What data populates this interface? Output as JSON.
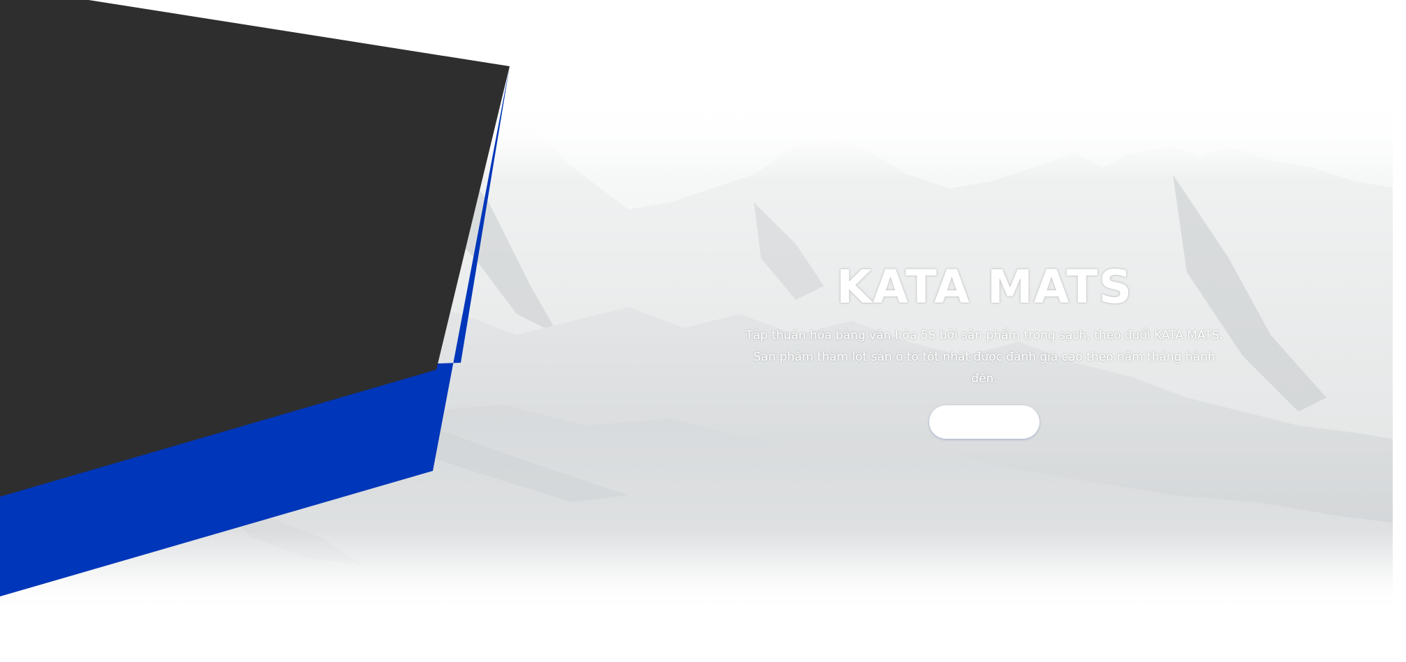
{
  "hero": {
    "title": "KATA MATS",
    "description": "Tập thuần hóa bằng văn hóa 5S bởi sản phẩm trong sạch, theo đuổi KATA MATS. Sản phẩm thảm lót sàn ô tô tốt nhất được đánh giá cao theo năm tháng hành đến.",
    "button_label": ""
  },
  "colors": {
    "dark_panel": "#2e2e2e",
    "accent_blue": "#0036b9",
    "background": "#ffffff"
  }
}
